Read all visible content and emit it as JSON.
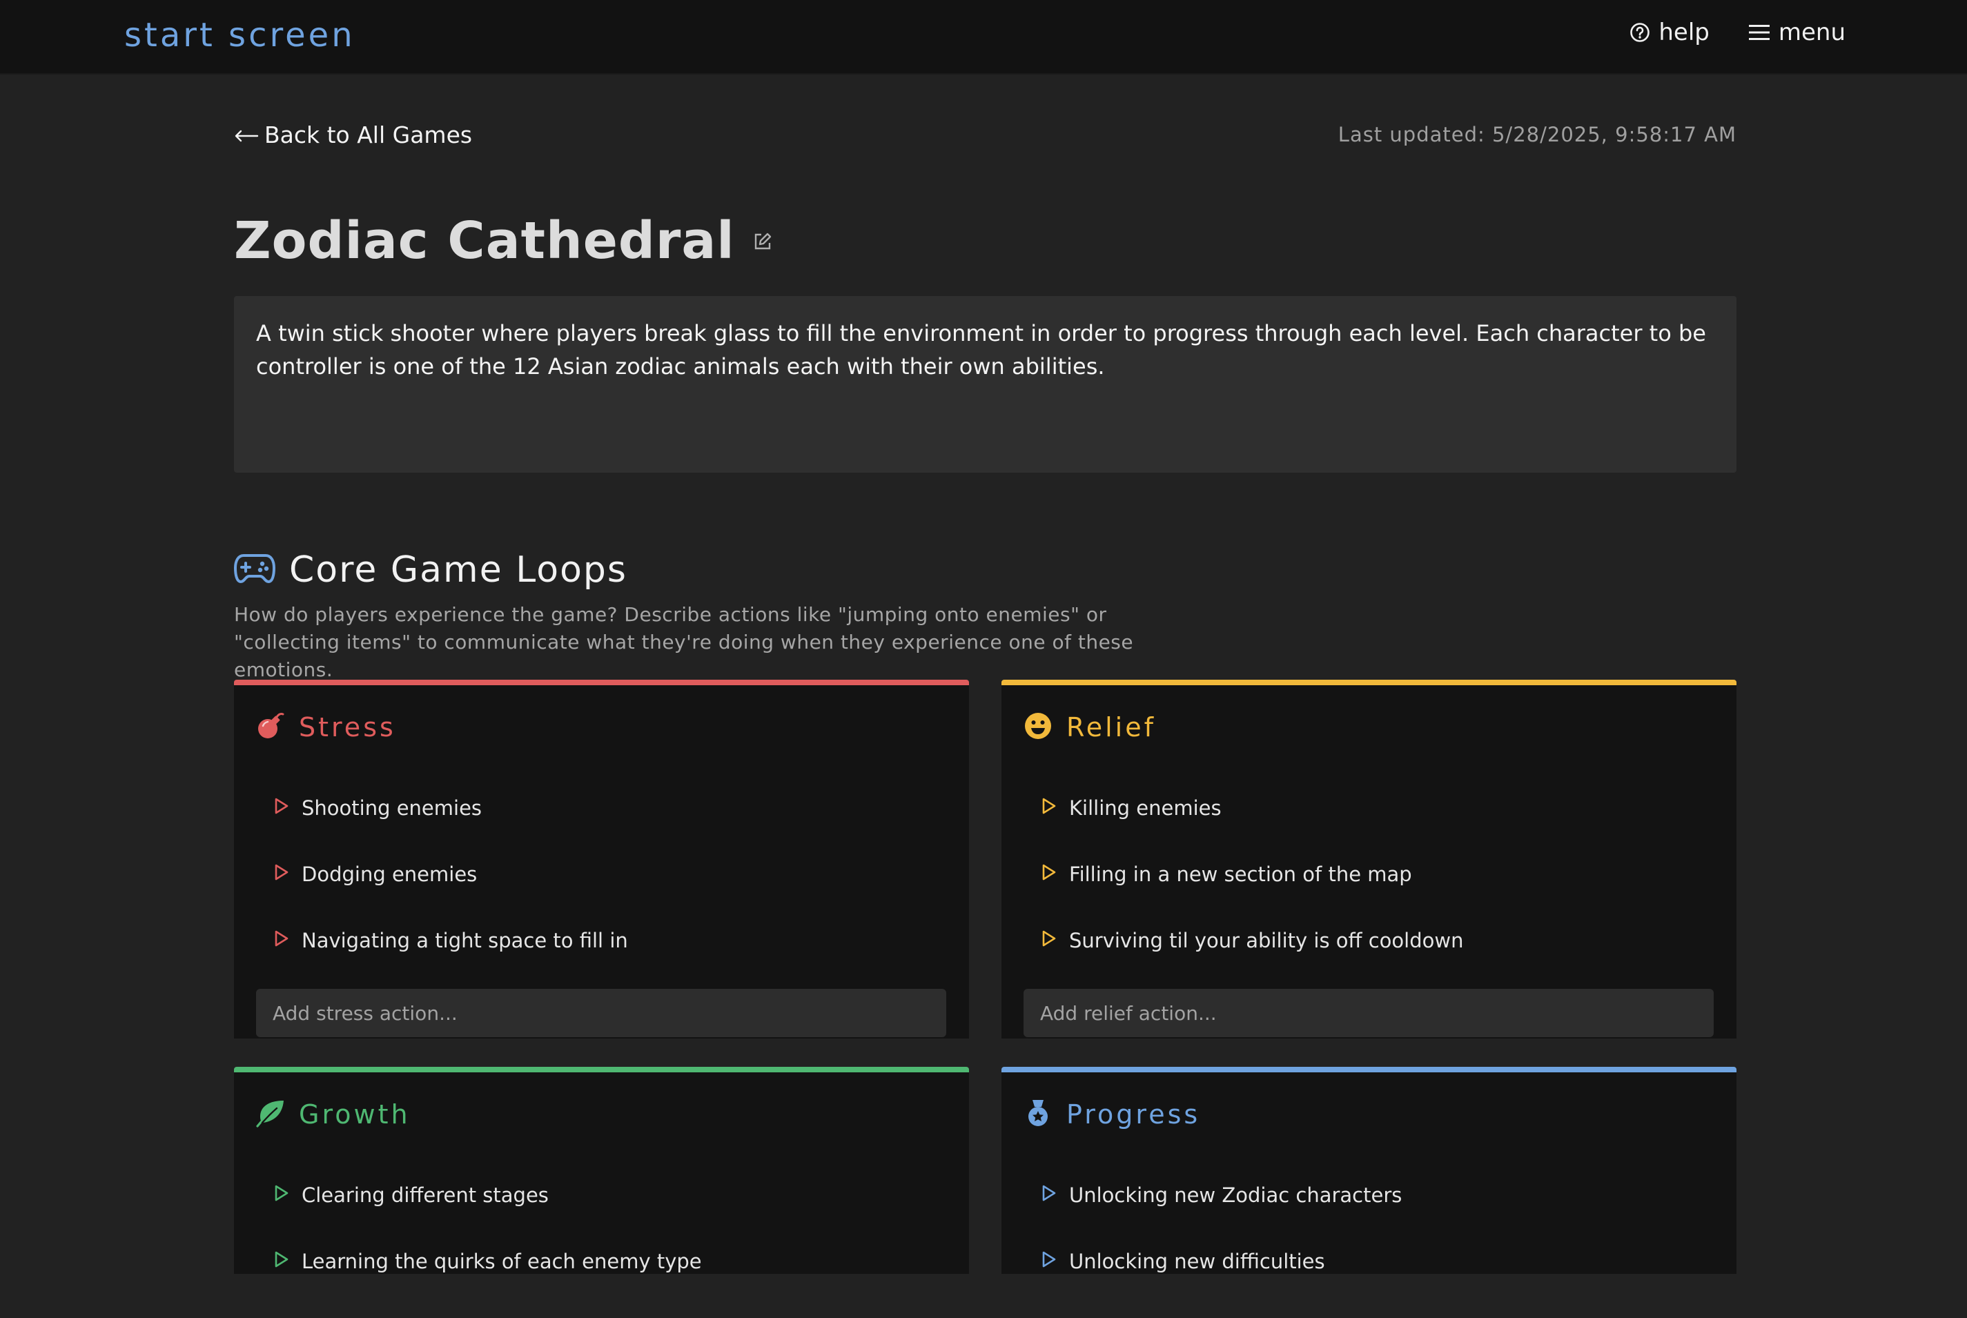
{
  "header": {
    "brand": "start screen",
    "help_label": "help",
    "menu_label": "menu"
  },
  "page": {
    "back_label": "Back to All Games",
    "last_updated": "Last updated: 5/28/2025, 9:58:17 AM",
    "title": "Zodiac Cathedral",
    "description": "A twin stick shooter where players break glass to fill the environment in order to progress through each level. Each character to be controller is one of the 12 Asian zodiac animals each with their own abilities."
  },
  "section": {
    "title": "Core Game Loops",
    "subtitle": "How do players experience the game? Describe actions like \"jumping onto enemies\" or \"collecting items\" to communicate what they're doing when they experience one of these emotions."
  },
  "cards": {
    "stress": {
      "title": "Stress",
      "color": "#e05c5c",
      "icon": "bomb-icon",
      "items": [
        "Shooting enemies",
        "Dodging enemies",
        "Navigating a tight space to fill in"
      ],
      "placeholder": "Add stress action..."
    },
    "relief": {
      "title": "Relief",
      "color": "#f2b93b",
      "icon": "smile-icon",
      "items": [
        "Killing enemies",
        "Filling in a new section of the map",
        "Surviving til your ability is off cooldown"
      ],
      "placeholder": "Add relief action..."
    },
    "growth": {
      "title": "Growth",
      "color": "#4fb872",
      "icon": "leaf-icon",
      "items": [
        "Clearing different stages",
        "Learning the quirks of each enemy type"
      ]
    },
    "progress": {
      "title": "Progress",
      "color": "#6fa3e0",
      "icon": "medal-icon",
      "items": [
        "Unlocking new Zodiac characters",
        "Unlocking new difficulties"
      ]
    }
  }
}
